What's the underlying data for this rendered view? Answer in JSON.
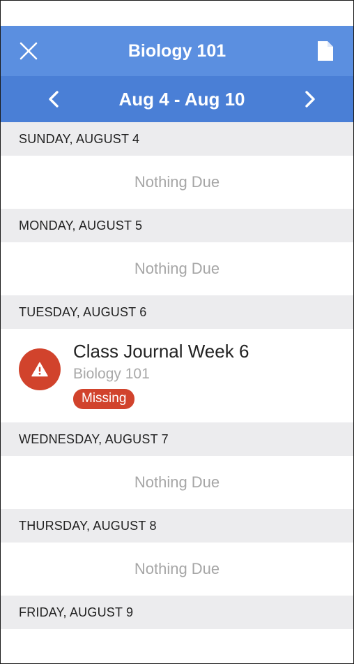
{
  "header": {
    "title": "Biology 101",
    "close_icon": "close-icon",
    "document_icon": "document-icon"
  },
  "week": {
    "range": "Aug 4 - Aug 10",
    "prev_icon": "chevron-left-icon",
    "next_icon": "chevron-right-icon"
  },
  "days": [
    {
      "label": "SUNDAY, AUGUST 4",
      "empty_text": "Nothing Due"
    },
    {
      "label": "MONDAY, AUGUST 5",
      "empty_text": "Nothing Due"
    },
    {
      "label": "TUESDAY, AUGUST 6",
      "assignment": {
        "title": "Class Journal Week 6",
        "course": "Biology 101",
        "status": "Missing",
        "icon": "alert-icon"
      }
    },
    {
      "label": "WEDNESDAY, AUGUST 7",
      "empty_text": "Nothing Due"
    },
    {
      "label": "THURSDAY, AUGUST 8",
      "empty_text": "Nothing Due"
    },
    {
      "label": "FRIDAY, AUGUST 9"
    }
  ],
  "colors": {
    "title_bar": "#5b8fe0",
    "week_bar": "#4a7fd6",
    "day_header_bg": "#ececee",
    "missing": "#d1432c"
  }
}
